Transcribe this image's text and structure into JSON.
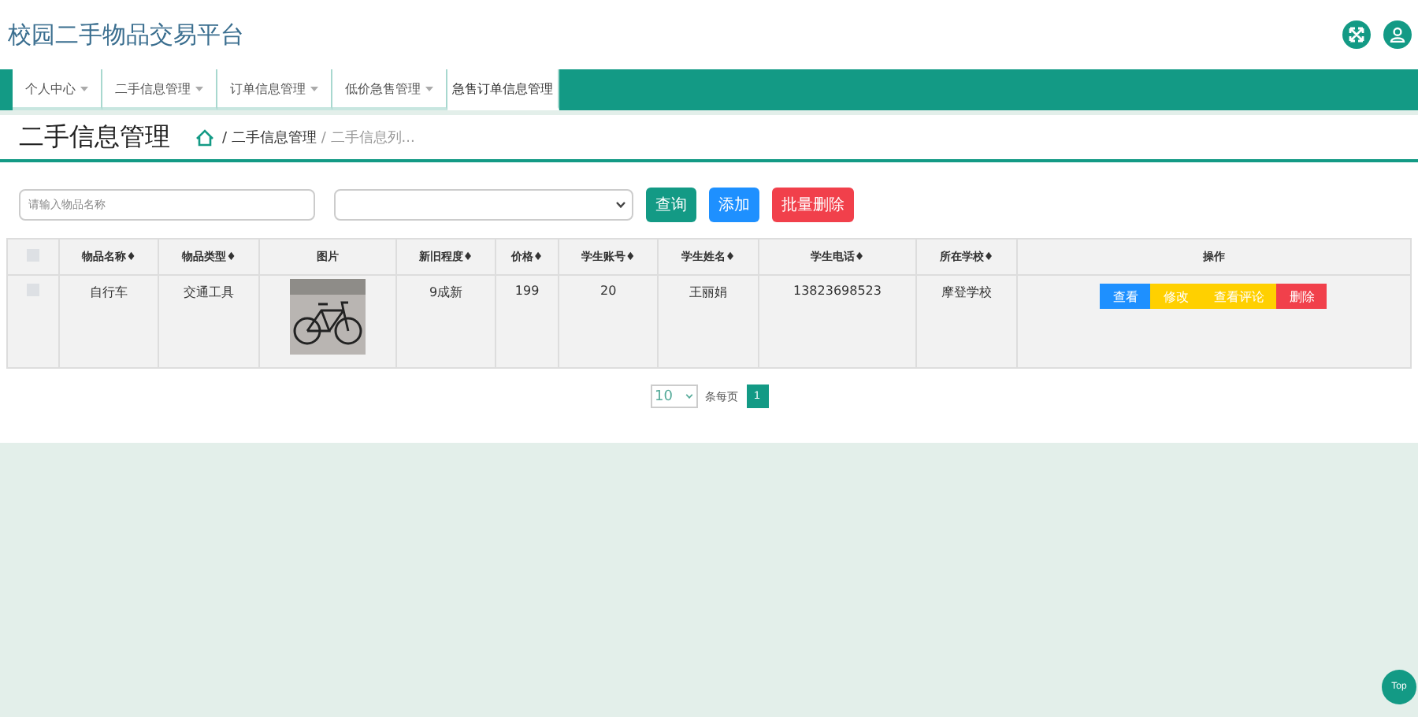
{
  "header": {
    "title": "校园二手物品交易平台"
  },
  "nav": [
    {
      "label": "个人中心",
      "dropdown": true,
      "selected": false
    },
    {
      "label": "二手信息管理",
      "dropdown": true,
      "selected": false
    },
    {
      "label": "订单信息管理",
      "dropdown": true,
      "selected": false
    },
    {
      "label": "低价急售管理",
      "dropdown": true,
      "selected": false
    },
    {
      "label": "急售订单信息管理",
      "dropdown": false,
      "selected": true
    }
  ],
  "page": {
    "title": "二手信息管理",
    "breadcrumb": [
      "/ 二手信息管理",
      "/ 二手信息列..."
    ]
  },
  "toolbar": {
    "search": {
      "placeholder": "请输入物品名称"
    },
    "buttons": [
      {
        "label": "查询",
        "kind": "primary"
      },
      {
        "label": "添加",
        "kind": "info"
      },
      {
        "label": "批量删除",
        "kind": "danger"
      }
    ]
  },
  "table": {
    "all_checked": false,
    "columns": [
      "物品名称♦",
      "物品类型♦",
      "图片",
      "新旧程度♦",
      "价格♦",
      "学生账号♦",
      "学生姓名♦",
      "学生电话♦",
      "所在学校♦",
      "操作"
    ],
    "rows": [
      {
        "checked": false,
        "cells": [
          "自行车",
          "交通工具",
          "",
          "9成新",
          "199",
          "20",
          "王丽娟",
          "13823698523",
          "摩登学校"
        ],
        "actions": [
          {
            "label": "查看",
            "kind": "info"
          },
          {
            "label": "修改",
            "kind": "warning"
          },
          {
            "label": "查看评论",
            "kind": "warning"
          },
          {
            "label": "删除",
            "kind": "danger"
          }
        ]
      }
    ]
  },
  "pagination": {
    "page_size": "10",
    "page_size_label": "条每页",
    "pages": [
      {
        "label": "1",
        "selected": true
      }
    ]
  },
  "back_to_top": "Top"
}
